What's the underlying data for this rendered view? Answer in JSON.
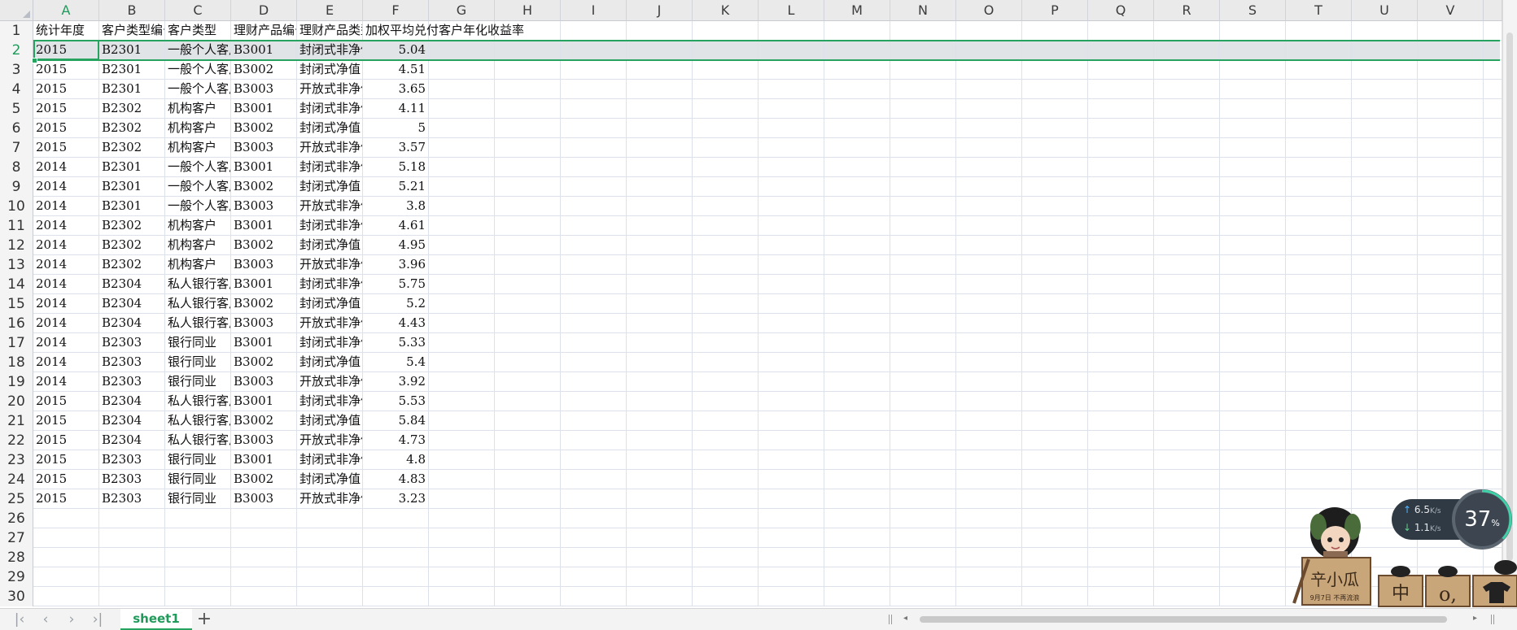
{
  "columns": [
    "A",
    "B",
    "C",
    "D",
    "E",
    "F",
    "G",
    "H",
    "I",
    "J",
    "K",
    "L",
    "M",
    "N",
    "O",
    "P",
    "Q",
    "R",
    "S",
    "T",
    "U",
    "V"
  ],
  "header_row": [
    "统计年度",
    "客户类型编号",
    "客户类型",
    "理财产品编号",
    "理财产品类型",
    "加权平均兑付客户年化收益率"
  ],
  "rows": [
    [
      "2015",
      "B2301",
      "一般个人客户",
      "B3001",
      "封闭式非净值",
      "5.04"
    ],
    [
      "2015",
      "B2301",
      "一般个人客户",
      "B3002",
      "封闭式净值",
      "4.51"
    ],
    [
      "2015",
      "B2301",
      "一般个人客户",
      "B3003",
      "开放式非净值",
      "3.65"
    ],
    [
      "2015",
      "B2302",
      "机构客户",
      "B3001",
      "封闭式非净值",
      "4.11"
    ],
    [
      "2015",
      "B2302",
      "机构客户",
      "B3002",
      "封闭式净值",
      "5"
    ],
    [
      "2015",
      "B2302",
      "机构客户",
      "B3003",
      "开放式非净值",
      "3.57"
    ],
    [
      "2014",
      "B2301",
      "一般个人客户",
      "B3001",
      "封闭式非净值",
      "5.18"
    ],
    [
      "2014",
      "B2301",
      "一般个人客户",
      "B3002",
      "封闭式净值",
      "5.21"
    ],
    [
      "2014",
      "B2301",
      "一般个人客户",
      "B3003",
      "开放式非净值",
      "3.8"
    ],
    [
      "2014",
      "B2302",
      "机构客户",
      "B3001",
      "封闭式非净值",
      "4.61"
    ],
    [
      "2014",
      "B2302",
      "机构客户",
      "B3002",
      "封闭式净值",
      "4.95"
    ],
    [
      "2014",
      "B2302",
      "机构客户",
      "B3003",
      "开放式非净值",
      "3.96"
    ],
    [
      "2014",
      "B2304",
      "私人银行客户",
      "B3001",
      "封闭式非净值",
      "5.75"
    ],
    [
      "2014",
      "B2304",
      "私人银行客户",
      "B3002",
      "封闭式净值",
      "5.2"
    ],
    [
      "2014",
      "B2304",
      "私人银行客户",
      "B3003",
      "开放式非净值",
      "4.43"
    ],
    [
      "2014",
      "B2303",
      "银行同业",
      "B3001",
      "封闭式非净值",
      "5.33"
    ],
    [
      "2014",
      "B2303",
      "银行同业",
      "B3002",
      "封闭式净值",
      "5.4"
    ],
    [
      "2014",
      "B2303",
      "银行同业",
      "B3003",
      "开放式非净值",
      "3.92"
    ],
    [
      "2015",
      "B2304",
      "私人银行客户",
      "B3001",
      "封闭式非净值",
      "5.53"
    ],
    [
      "2015",
      "B2304",
      "私人银行客户",
      "B3002",
      "封闭式净值",
      "5.84"
    ],
    [
      "2015",
      "B2304",
      "私人银行客户",
      "B3003",
      "开放式非净值",
      "4.73"
    ],
    [
      "2015",
      "B2303",
      "银行同业",
      "B3001",
      "封闭式非净值",
      "4.8"
    ],
    [
      "2015",
      "B2303",
      "银行同业",
      "B3002",
      "封闭式净值",
      "4.83"
    ],
    [
      "2015",
      "B2303",
      "银行同业",
      "B3003",
      "开放式非净值",
      "3.23"
    ]
  ],
  "selected_row": 2,
  "sheet_tabs": [
    "sheet1"
  ],
  "net_widget": {
    "up_value": "6.5",
    "up_unit": "K/s",
    "down_value": "1.1",
    "down_unit": "K/s",
    "percent": "37",
    "percent_unit": "%"
  },
  "mascot_box_labels": [
    "中",
    "9月7日 不再流浪"
  ],
  "colors": {
    "accent": "#26a35f",
    "grid": "#dde2ea",
    "header_bg": "#eaeaea"
  }
}
